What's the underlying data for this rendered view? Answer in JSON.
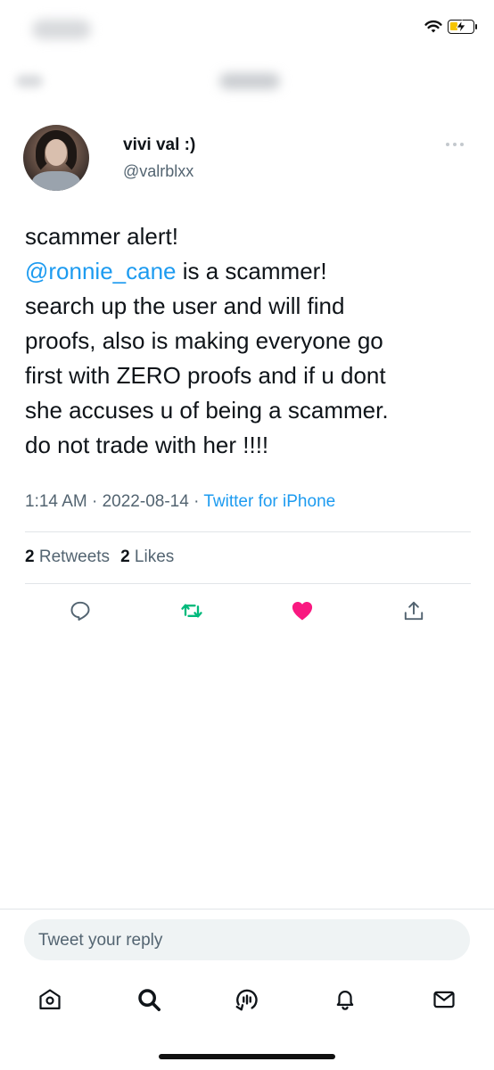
{
  "colors": {
    "text": "#0f1419",
    "secondary": "#536471",
    "link": "#1d9bf0",
    "retweet_green": "#00ba7c",
    "like_pink": "#f91880"
  },
  "tweet": {
    "author": {
      "display_name": "vivi val :)",
      "handle": "@valrblxx"
    },
    "text": {
      "line1": "scammer alert!",
      "mention": "@ronnie_cane",
      "line2_rest": " is a scammer!",
      "line3": "search up the user and will find",
      "line4": "proofs, also is making everyone go",
      "line5": "first with ZERO proofs and if u dont",
      "line6": "she accuses u of being a scammer.",
      "line7": "do not trade with her !!!!"
    },
    "meta": {
      "time": "1:14 AM",
      "sep1": " · ",
      "date": "2022-08-14",
      "sep2": " · ",
      "source": "Twitter for iPhone"
    },
    "stats": {
      "retweets_count": "2",
      "retweets_label": "Retweets",
      "likes_count": "2",
      "likes_label": "Likes"
    },
    "actions": [
      {
        "icon": "reply-icon"
      },
      {
        "icon": "retweet-icon",
        "state": "active"
      },
      {
        "icon": "like-icon",
        "state": "liked"
      },
      {
        "icon": "share-icon"
      }
    ]
  },
  "reply": {
    "placeholder": "Tweet your reply"
  },
  "tabbar": [
    {
      "icon": "home-icon"
    },
    {
      "icon": "search-icon"
    },
    {
      "icon": "spaces-icon"
    },
    {
      "icon": "notifications-icon"
    },
    {
      "icon": "messages-icon"
    }
  ]
}
